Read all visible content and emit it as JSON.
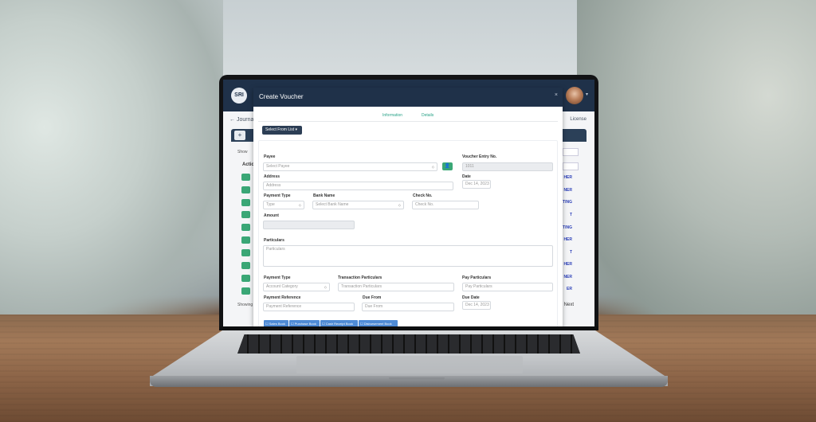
{
  "app": {
    "brand": "SRI",
    "breadcrumb": "Journa",
    "side_label": "License",
    "tab_plus": "+",
    "show_label": "Show",
    "actions_header": "Actio",
    "showing_label": "Showing",
    "next_label": "Next",
    "right_links": [
      "HER",
      "NER",
      "TING",
      "T",
      "TING",
      "HER",
      "T",
      "HER",
      "NER",
      "ER"
    ]
  },
  "modal": {
    "title": "Create Voucher",
    "close": "×",
    "tabs": [
      "Information",
      "Details"
    ],
    "select_from_list": "Select From List ▾",
    "form": {
      "payee_label": "Payee",
      "payee_placeholder": "Select Payee",
      "voucher_entry_label": "Voucher Entry No.",
      "voucher_entry_value": "1011",
      "address_label": "Address",
      "address_placeholder": "Address",
      "date_label": "Date",
      "date_value": "Dec 14, 2023",
      "payment_type_label": "Payment Type",
      "payment_type_value": "Type",
      "bank_name_label": "Bank Name",
      "bank_name_value": "Select Bank Name",
      "check_no_label": "Check No.",
      "check_no_placeholder": "Check No.",
      "amount_label": "Amount",
      "particulars_label": "Particulars",
      "particulars_placeholder": "Particulars",
      "payment_type2_label": "Payment Type",
      "account_category_value": "Account Category",
      "transaction_particulars_label": "Transaction Particulars",
      "transaction_particulars_placeholder": "Transaction Particulars",
      "pay_particulars_label": "Pay Particulars",
      "pay_particulars_placeholder": "Pay Particulars",
      "payment_reference_label": "Payment Reference",
      "payment_reference_placeholder": "Payment Reference",
      "due_from_label": "Due From",
      "due_from_placeholder": "Due From",
      "due_date_label": "Due Date",
      "due_date_value": "Dec 14, 2023"
    },
    "books": [
      "Sales Book",
      "Purchase Book",
      "Cash Receipt Book",
      "Disbursement Book"
    ]
  },
  "colors": {
    "header": "#1f3149",
    "accent_green": "#3aa776",
    "tab_text": "#2aa388",
    "book_button": "#4f8bd6"
  }
}
